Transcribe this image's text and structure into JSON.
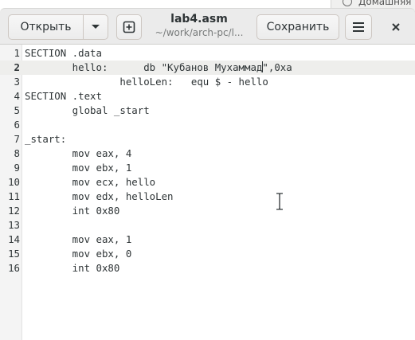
{
  "background_window": {
    "title": "Домашняя"
  },
  "headerbar": {
    "open_label": "Открыть",
    "save_label": "Сохранить",
    "title": "lab4.asm",
    "subtitle": "~/work/arch-pc/l..."
  },
  "icons": {
    "dropdown": "chevron-down-icon",
    "new_tab": "new-tab-icon",
    "menu": "hamburger-menu-icon",
    "close": "close-icon"
  },
  "editor": {
    "current_line": 2,
    "lines": [
      {
        "num": "1",
        "text": "SECTION .data"
      },
      {
        "num": "2",
        "text_before_cursor": "        hello:      db \"Кубанов Мухаммад",
        "text_after_cursor": "\",0xa"
      },
      {
        "num": "3",
        "text": "                helloLen:   equ $ - hello"
      },
      {
        "num": "4",
        "text": "SECTION .text"
      },
      {
        "num": "5",
        "text": "        global _start"
      },
      {
        "num": "6",
        "text": ""
      },
      {
        "num": "7",
        "text": "_start:"
      },
      {
        "num": "8",
        "text": "        mov eax, 4"
      },
      {
        "num": "9",
        "text": "        mov ebx, 1"
      },
      {
        "num": "10",
        "text": "        mov ecx, hello"
      },
      {
        "num": "11",
        "text": "        mov edx, helloLen"
      },
      {
        "num": "12",
        "text": "        int 0x80"
      },
      {
        "num": "13",
        "text": ""
      },
      {
        "num": "14",
        "text": "        mov eax, 1"
      },
      {
        "num": "15",
        "text": "        mov ebx, 0"
      },
      {
        "num": "16",
        "text": "        int 0x80"
      }
    ]
  },
  "colors": {
    "headerbar_bg": "#ebebeb",
    "current_line_bg": "#eeeeec",
    "gutter_bg": "#f4f4f4",
    "text": "#2e3436"
  }
}
